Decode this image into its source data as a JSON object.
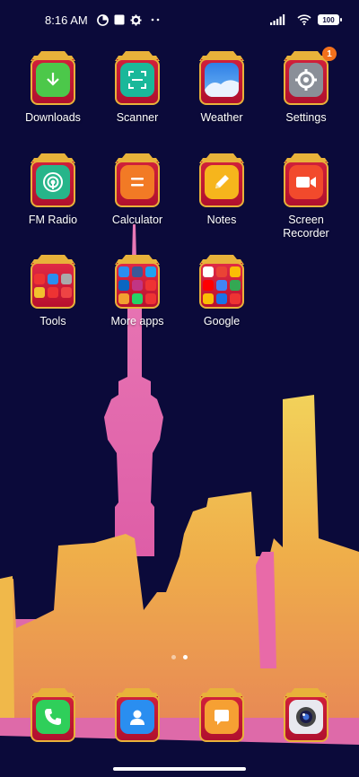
{
  "status_bar": {
    "time": "8:16 AM",
    "battery": "100",
    "icons": [
      "data-saver-icon",
      "square-notification-icon",
      "gear-icon",
      "more-dots-icon",
      "signal-icon",
      "wifi-icon",
      "battery-icon"
    ]
  },
  "apps": [
    {
      "id": "downloads",
      "label": "Downloads",
      "icon": "download-arrow-icon",
      "color": "#4cc84a"
    },
    {
      "id": "scanner",
      "label": "Scanner",
      "icon": "scan-frame-icon",
      "color": "#1ab89a"
    },
    {
      "id": "weather",
      "label": "Weather",
      "icon": "cloud-icon",
      "color": "#3b8fe8"
    },
    {
      "id": "settings",
      "label": "Settings",
      "icon": "gear-icon",
      "color": "#8a8f98",
      "badge": "1"
    },
    {
      "id": "fm-radio",
      "label": "FM Radio",
      "icon": "radio-icon",
      "color": "#27b58a"
    },
    {
      "id": "calculator",
      "label": "Calculator",
      "icon": "equals-icon",
      "color": "#f27a25"
    },
    {
      "id": "notes",
      "label": "Notes",
      "icon": "pencil-icon",
      "color": "#f6b51c"
    },
    {
      "id": "screen-recorder",
      "label": "Screen Recorder",
      "icon": "video-camera-icon",
      "color": "#f24a2c"
    },
    {
      "id": "tools",
      "label": "Tools",
      "icon": "folder-icon"
    },
    {
      "id": "more-apps",
      "label": "More apps",
      "icon": "folder-icon"
    },
    {
      "id": "google",
      "label": "Google",
      "icon": "folder-icon"
    }
  ],
  "dock": [
    {
      "id": "phone",
      "icon": "phone-icon",
      "color": "#2fcf5a"
    },
    {
      "id": "contacts",
      "icon": "contact-icon",
      "color": "#2a8ef0"
    },
    {
      "id": "messages",
      "icon": "message-icon",
      "color": "#f6a033"
    },
    {
      "id": "camera",
      "icon": "camera-icon",
      "color": "#e8e8ef"
    }
  ],
  "page_indicator": {
    "pages": 2,
    "current": 2
  },
  "colors": {
    "background": "#0b0a3a",
    "tower": "#e56fb3",
    "buildings": "#f0b84a",
    "roof": "#e8b23a",
    "frame": "#c5162f"
  }
}
